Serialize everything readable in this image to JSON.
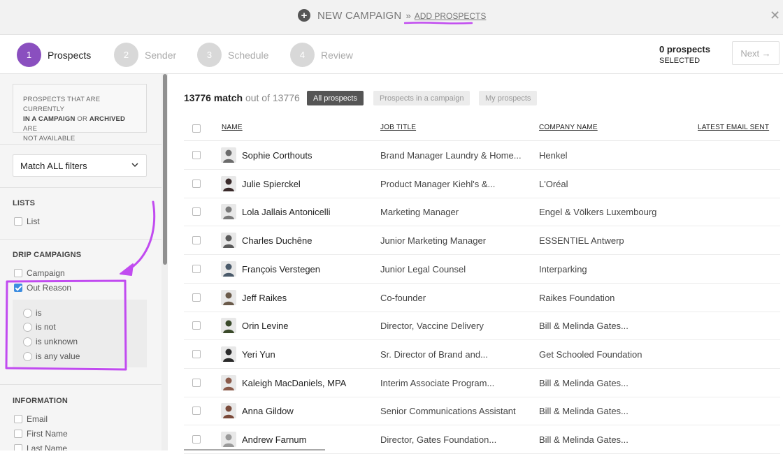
{
  "header": {
    "title": "NEW CAMPAIGN",
    "separator": "»",
    "subtitle": "ADD PROSPECTS"
  },
  "steps": [
    {
      "num": "1",
      "label": "Prospects",
      "active": true
    },
    {
      "num": "2",
      "label": "Sender",
      "active": false
    },
    {
      "num": "3",
      "label": "Schedule",
      "active": false
    },
    {
      "num": "4",
      "label": "Review",
      "active": false
    }
  ],
  "selection": {
    "count": "0 prospects",
    "label": "SELECTED",
    "next_label": "Next →"
  },
  "sidebar": {
    "notice_line1": "PROSPECTS THAT ARE CURRENTLY",
    "notice_b1": "IN A CAMPAIGN",
    "notice_or": " OR ",
    "notice_b2": "ARCHIVED",
    "notice_are": " ARE",
    "notice_line3": "NOT AVAILABLE",
    "match_select": "Match ALL filters",
    "lists_title": "LISTS",
    "lists_item": "List",
    "drip_title": "DRIP CAMPAIGNS",
    "drip_items": [
      "Campaign",
      "Out Reason"
    ],
    "radios": [
      "is",
      "is not",
      "is unknown",
      "is any value"
    ],
    "info_title": "INFORMATION",
    "info_items": [
      "Email",
      "First Name",
      "Last Name"
    ]
  },
  "main": {
    "match_count": "13776 match",
    "match_rest": " out of 13776",
    "pills": [
      "All prospects",
      "Prospects in a campaign",
      "My prospects"
    ],
    "columns": [
      "NAME",
      "JOB TITLE",
      "COMPANY NAME",
      "LATEST EMAIL SENT"
    ],
    "rows": [
      {
        "name": "Sophie Corthouts",
        "job": "Brand Manager Laundry & Home...",
        "company": "Henkel"
      },
      {
        "name": "Julie Spierckel",
        "job": "Product Manager Kiehl's &...",
        "company": "L'Oréal"
      },
      {
        "name": "Lola Jallais Antonicelli",
        "job": "Marketing Manager",
        "company": "Engel & Völkers Luxembourg"
      },
      {
        "name": "Charles Duchêne",
        "job": "Junior Marketing Manager",
        "company": "ESSENTIEL Antwerp"
      },
      {
        "name": "François Verstegen",
        "job": "Junior Legal Counsel",
        "company": "Interparking"
      },
      {
        "name": "Jeff Raikes",
        "job": "Co-founder",
        "company": "Raikes Foundation"
      },
      {
        "name": "Orin Levine",
        "job": "Director, Vaccine Delivery",
        "company": "Bill & Melinda Gates..."
      },
      {
        "name": "Yeri Yun",
        "job": "Sr. Director of Brand and...",
        "company": "Get Schooled Foundation"
      },
      {
        "name": "Kaleigh MacDaniels, MPA",
        "job": "Interim Associate Program...",
        "company": "Bill & Melinda Gates..."
      },
      {
        "name": "Anna Gildow",
        "job": "Senior Communications Assistant",
        "company": "Bill & Melinda Gates..."
      },
      {
        "name": "Andrew Farnum",
        "job": "Director, Gates Foundation...",
        "company": "Bill & Melinda Gates..."
      }
    ]
  },
  "colors": {
    "accent": "#8a4fbf",
    "annotation": "#c14bf0",
    "checkbox_checked": "#3d8de0"
  }
}
